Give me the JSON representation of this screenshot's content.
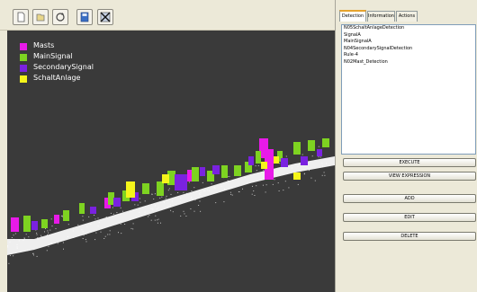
{
  "toolbar": {
    "buttons": [
      {
        "name": "new-document-button",
        "icon": "page-icon"
      },
      {
        "name": "open-button",
        "icon": "open-icon"
      },
      {
        "name": "refresh-button",
        "icon": "refresh-icon"
      },
      {
        "name": "save-disk-button",
        "icon": "disk-icon"
      },
      {
        "name": "clear-button",
        "icon": "x-icon"
      }
    ]
  },
  "viewport": {
    "background_color": "#3a3a3a",
    "legend": [
      {
        "label": "Masts",
        "color": "#e81ae8"
      },
      {
        "label": "MainSignal",
        "color": "#7ed321"
      },
      {
        "label": "SecondarySignal",
        "color": "#7a22e0"
      },
      {
        "label": "SchaltAnlage",
        "color": "#f5f51a"
      }
    ]
  },
  "panel": {
    "tabs": [
      {
        "label": "Detection",
        "active": true
      },
      {
        "label": "Information",
        "active": false
      },
      {
        "label": "Actions",
        "active": false
      }
    ],
    "list_items": [
      "N05SchaltAnlageDetection",
      "SignalA",
      "MainSignalA",
      "N04SecondarySignalDetection",
      "Rule-4",
      "N02Mast_Detection"
    ],
    "buttons": {
      "execute": "EXECUTE",
      "view_expression": "VIEW EXPRESSION",
      "add": "ADD",
      "edit": "EDIT",
      "delete": "DELETE"
    }
  }
}
